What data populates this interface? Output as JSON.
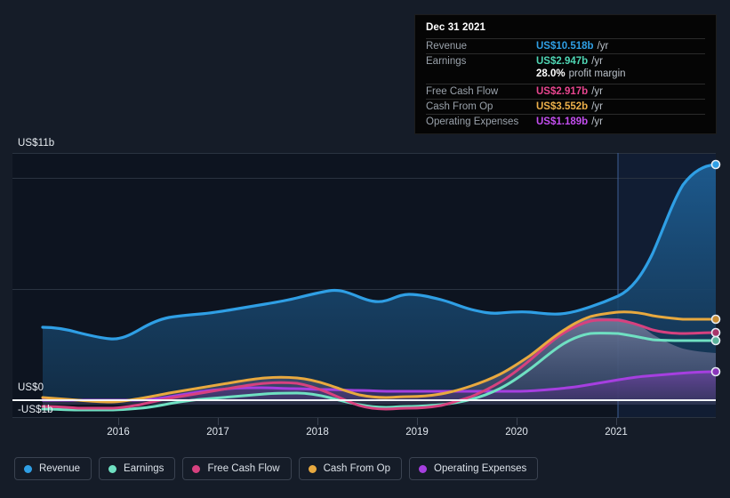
{
  "axes": {
    "y_top_label": "US$11b",
    "y_zero_label": "US$0",
    "y_neg_label": "-US$1b",
    "x_labels": [
      "2016",
      "2017",
      "2018",
      "2019",
      "2020",
      "2021"
    ]
  },
  "tooltip": {
    "date": "Dec 31 2021",
    "rows": [
      {
        "name": "Revenue",
        "value": "US$10.518b",
        "unit": "/yr",
        "color_key": "rev"
      },
      {
        "name": "Earnings",
        "value": "US$2.947b",
        "unit": "/yr",
        "color_key": "earn"
      },
      {
        "name": "",
        "value": "28.0%",
        "unit": "profit margin",
        "color_key": "margin"
      },
      {
        "name": "Free Cash Flow",
        "value": "US$2.917b",
        "unit": "/yr",
        "color_key": "fcf"
      },
      {
        "name": "Cash From Op",
        "value": "US$3.552b",
        "unit": "/yr",
        "color_key": "cfo"
      },
      {
        "name": "Operating Expenses",
        "value": "US$1.189b",
        "unit": "/yr",
        "color_key": "opex"
      }
    ]
  },
  "legend": [
    {
      "label": "Revenue",
      "color": "#2f9fe5"
    },
    {
      "label": "Earnings",
      "color": "#6fe0c2"
    },
    {
      "label": "Free Cash Flow",
      "color": "#d6417f"
    },
    {
      "label": "Cash From Op",
      "color": "#e8a93f"
    },
    {
      "label": "Operating Expenses",
      "color": "#a63fe0"
    }
  ],
  "colors": {
    "page_bg": "#151c28",
    "plot_bg": "#0d1420",
    "forecast_bg": "#13203a",
    "gridline": "#2a3340",
    "zero_line": "#f2f5f8",
    "revenue": "#2f9fe5",
    "earnings": "#6fe0c2",
    "free_cash_flow": "#d6417f",
    "cash_from_op": "#e8a93f",
    "operating_expenses": "#a63fe0"
  },
  "chart_data": {
    "type": "area",
    "title": "",
    "xlabel": "",
    "ylabel": "",
    "ylim": [
      -1,
      11
    ],
    "y_unit": "US$b",
    "grid": true,
    "legend_position": "bottom",
    "x_tick_labels": [
      "2016",
      "2017",
      "2018",
      "2019",
      "2020",
      "2021"
    ],
    "x": [
      2015.4,
      2015.75,
      2016.0,
      2016.25,
      2016.5,
      2016.75,
      2017.0,
      2017.25,
      2017.5,
      2017.75,
      2018.0,
      2018.25,
      2018.5,
      2018.75,
      2019.0,
      2019.25,
      2019.5,
      2019.75,
      2020.0,
      2020.25,
      2020.5,
      2020.75,
      2021.0,
      2021.25,
      2021.5,
      2021.75,
      2022.0
    ],
    "forecast_boundary_x": 2021.0,
    "series": [
      {
        "name": "Revenue",
        "color": "#2f9fe5",
        "end_value": 10.518,
        "values": [
          3.25,
          3.24,
          3.05,
          2.92,
          2.88,
          2.95,
          3.28,
          3.52,
          3.66,
          3.74,
          3.8,
          3.92,
          4.08,
          4.3,
          4.7,
          4.95,
          4.72,
          4.62,
          4.6,
          4.28,
          4.18,
          4.05,
          4.32,
          4.8,
          6.5,
          9.1,
          10.518
        ]
      },
      {
        "name": "Earnings",
        "color": "#6fe0c2",
        "end_value": 2.947,
        "values": [
          -0.42,
          -0.44,
          -0.46,
          -0.46,
          -0.44,
          -0.4,
          -0.32,
          -0.26,
          -0.2,
          -0.14,
          -0.08,
          -0.02,
          0.04,
          0.1,
          0.14,
          0.1,
          0.0,
          -0.12,
          -0.2,
          -0.24,
          -0.22,
          -0.14,
          0.05,
          0.42,
          1.3,
          2.45,
          2.947
        ]
      },
      {
        "name": "Free Cash Flow",
        "color": "#d6417f",
        "end_value": 2.917,
        "values": [
          -0.3,
          -0.32,
          -0.33,
          -0.34,
          -0.32,
          -0.26,
          -0.18,
          -0.1,
          -0.04,
          0.02,
          0.08,
          0.16,
          0.24,
          0.32,
          0.38,
          0.3,
          0.1,
          -0.14,
          -0.3,
          -0.36,
          -0.33,
          -0.22,
          0.1,
          0.55,
          1.55,
          2.6,
          2.917
        ]
      },
      {
        "name": "Cash From Op",
        "color": "#e8a93f",
        "end_value": 3.552,
        "values": [
          0.1,
          0.08,
          0.04,
          -0.02,
          -0.06,
          -0.06,
          -0.02,
          0.06,
          0.14,
          0.22,
          0.3,
          0.4,
          0.5,
          0.58,
          0.64,
          0.56,
          0.36,
          0.14,
          -0.02,
          -0.08,
          -0.04,
          0.08,
          0.38,
          0.85,
          1.9,
          3.0,
          3.552
        ]
      },
      {
        "name": "Operating Expenses",
        "color": "#a63fe0",
        "end_value": 1.189,
        "values": [
          0.0,
          0.0,
          0.0,
          0.02,
          0.06,
          0.12,
          0.22,
          0.3,
          0.34,
          0.38,
          0.42,
          0.46,
          0.5,
          0.53,
          0.55,
          0.55,
          0.53,
          0.5,
          0.48,
          0.46,
          0.46,
          0.5,
          0.62,
          0.78,
          0.95,
          1.1,
          1.189
        ]
      }
    ]
  }
}
